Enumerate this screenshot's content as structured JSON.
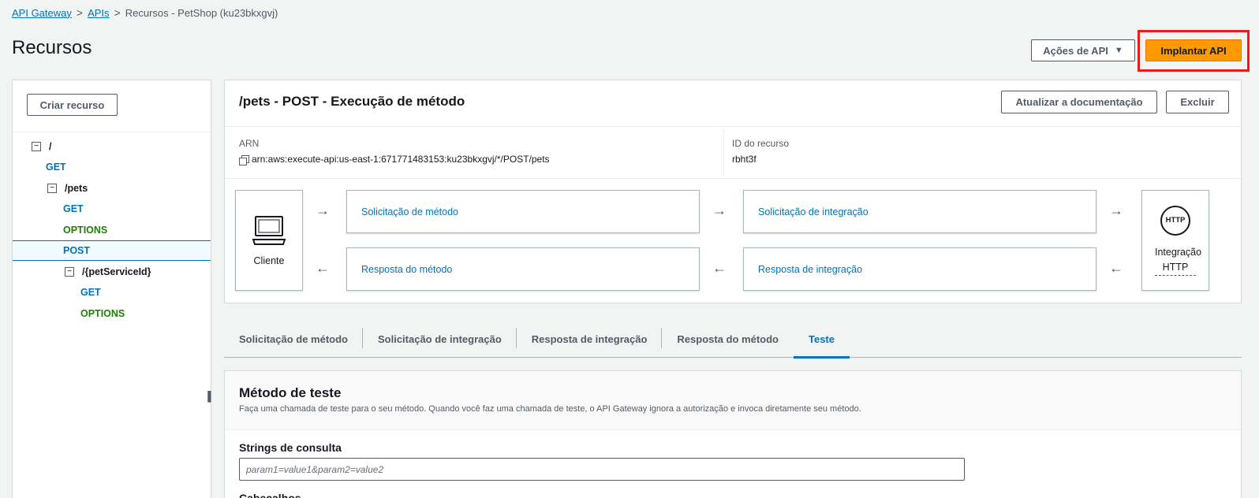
{
  "breadcrumb": {
    "items": [
      "API Gateway",
      "APIs"
    ],
    "current": "Recursos - PetShop (ku23bkxgvj)"
  },
  "page": {
    "title": "Recursos",
    "actions_label": "Ações de API",
    "deploy_label": "Implantar API"
  },
  "sidebar": {
    "create_label": "Criar recurso",
    "tree": [
      {
        "label": "/",
        "type": "path"
      },
      {
        "label": "GET",
        "type": "get"
      },
      {
        "label": "/pets",
        "type": "path"
      },
      {
        "label": "GET",
        "type": "get"
      },
      {
        "label": "OPTIONS",
        "type": "options"
      },
      {
        "label": "POST",
        "type": "post",
        "selected": true
      },
      {
        "label": "/{petServiceId}",
        "type": "path"
      },
      {
        "label": "GET",
        "type": "get"
      },
      {
        "label": "OPTIONS",
        "type": "options"
      }
    ]
  },
  "method": {
    "title": "/pets - POST - Execução de método",
    "update_docs_label": "Atualizar a documentação",
    "delete_label": "Excluir",
    "arn_label": "ARN",
    "arn_value": "arn:aws:execute-api:us-east-1:671771483153:ku23bkxgvj/*/POST/pets",
    "resource_id_label": "ID do recurso",
    "resource_id_value": "rbht3f"
  },
  "flow": {
    "client_label": "Cliente",
    "method_request": "Solicitação de método",
    "integration_request": "Solicitação de integração",
    "method_response": "Resposta do método",
    "integration_response": "Resposta de integração",
    "http_badge": "HTTP",
    "integration_type": "Integração HTTP",
    "arrow_right": "→",
    "arrow_left": "←"
  },
  "tabs": [
    {
      "label": "Solicitação de método"
    },
    {
      "label": "Solicitação de integração"
    },
    {
      "label": "Resposta de integração"
    },
    {
      "label": "Resposta do método"
    },
    {
      "label": "Teste",
      "active": true
    }
  ],
  "test": {
    "title": "Método de teste",
    "description": "Faça uma chamada de teste para o seu método. Quando você faz uma chamada de teste, o API Gateway ignora a autorização e invoca diretamente seu método.",
    "query_label": "Strings de consulta",
    "query_placeholder": "param1=value1&param2=value2",
    "next_label": "Cabeçalhos"
  },
  "colors": {
    "link": "#0073bb",
    "deploy_button": "#ff9900",
    "highlight": "#ea1c1c",
    "options_method": "#1d8102"
  }
}
